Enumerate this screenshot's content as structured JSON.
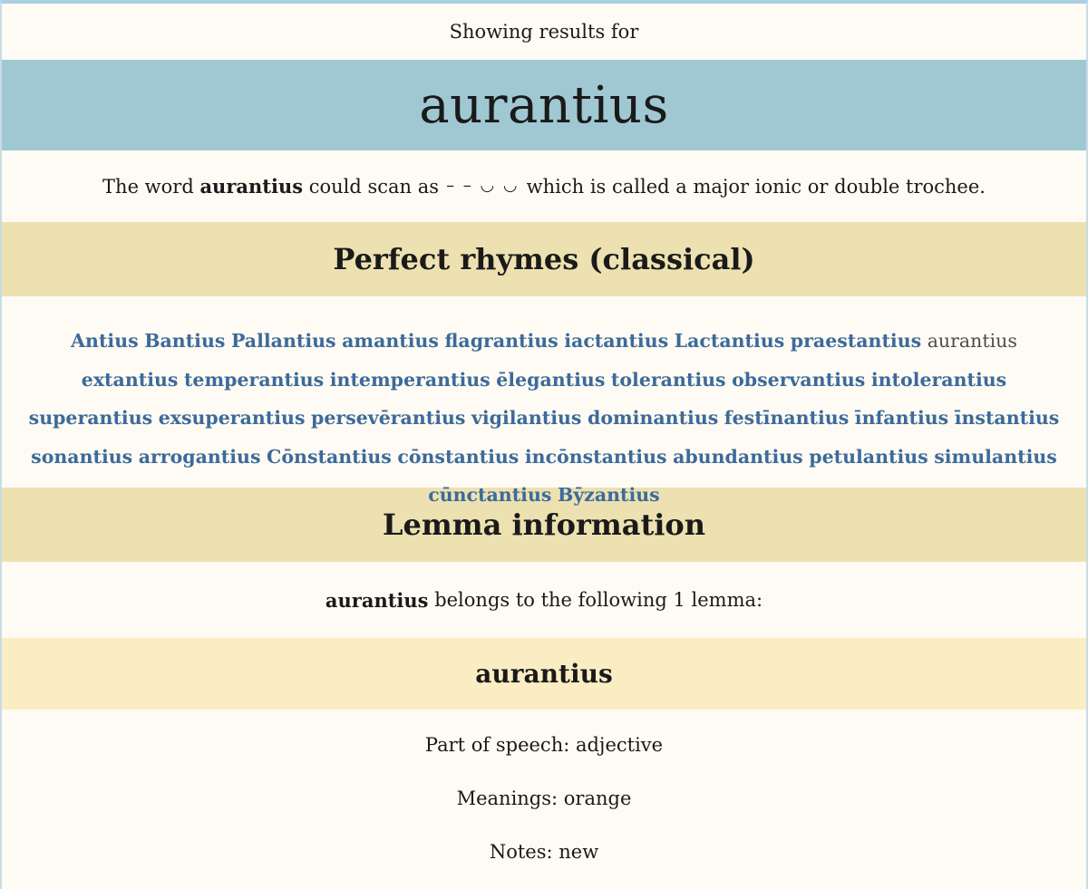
{
  "header": {
    "showing_label": "Showing results for",
    "word": "aurantius"
  },
  "scansion": {
    "prefix": "The word",
    "word": "aurantius",
    "middle": "could scan as",
    "meter": "– – ◡ ◡",
    "suffix": "which is called a major ionic or double trochee."
  },
  "rhymes_section": {
    "title": "Perfect rhymes (classical)",
    "items": [
      "Antius",
      "Bantius",
      "Pallantius",
      "amantius",
      "flagrantius",
      "iactantius",
      "Lactantius",
      "praestantius",
      "aurantius",
      "extantius",
      "temperantius",
      "intemperantius",
      "ēlegantius",
      "tolerantius",
      "observantius",
      "intolerantius",
      "superantius",
      "exsuperantius",
      "persevērantius",
      "vigilantius",
      "dominantius",
      "festīnantius",
      "īnfantius",
      "īnstantius",
      "sonantius",
      "arrogantius",
      "Cōnstantius",
      "cōnstantius",
      "incōnstantius",
      "abundantius",
      "petulantius",
      "simulantius",
      "cūnctantius",
      "Bȳzantius"
    ],
    "current_index": 8
  },
  "lemma_section": {
    "title": "Lemma information",
    "intro_word": "aurantius",
    "intro_text": "belongs to the following 1 lemma:",
    "lemma": {
      "name": "aurantius",
      "part_of_speech": "Part of speech: adjective",
      "meanings": "Meanings: orange",
      "notes": "Notes: new"
    }
  },
  "colors": {
    "word_band": "#a0c8d2",
    "section_band": "#ede1b2",
    "lemma_band": "#faedc4",
    "link": "#3d6a9b",
    "background": "#fdfbf3"
  }
}
